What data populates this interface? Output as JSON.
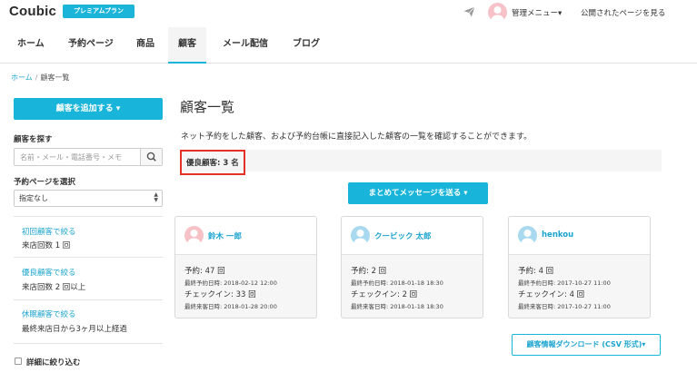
{
  "header": {
    "logo": "Coubic",
    "plan_badge": "プレミアムプラン",
    "admin_menu": "管理メニュー▾",
    "public_link": "公開されたページを見る"
  },
  "nav": {
    "tabs": [
      {
        "label": "ホーム",
        "active": false
      },
      {
        "label": "予約ページ",
        "active": false
      },
      {
        "label": "商品",
        "active": false
      },
      {
        "label": "顧客",
        "active": true
      },
      {
        "label": "メール配信",
        "active": false
      },
      {
        "label": "ブログ",
        "active": false
      }
    ]
  },
  "breadcrumb": {
    "home": "ホーム",
    "separator": "/",
    "current": "顧客一覧"
  },
  "sidebar": {
    "add_button": "顧客を追加する ▾",
    "search_label": "顧客を探す",
    "search_placeholder": "名前・メール・電話番号・メモ",
    "page_select_label": "予約ページを選択",
    "page_select_value": "指定なし",
    "filters": [
      {
        "title": "初回顧客で絞る",
        "desc": "来店回数 1 回"
      },
      {
        "title": "優良顧客で絞る",
        "desc": "来店回数 2 回以上"
      },
      {
        "title": "休眠顧客で絞る",
        "desc": "最終来店日から3ヶ月以上経過"
      }
    ],
    "detail_filter_label": "詳細に絞り込む"
  },
  "main": {
    "title": "顧客一覧",
    "description": "ネット予約をした顧客、および予約台帳に直接記入した顧客の一覧を確認することができます。",
    "good_customers": "優良顧客: 3 名",
    "bulk_message_button": "まとめてメッセージを送る ▾",
    "csv_button": "顧客情報ダウンロード (CSV 形式)▾",
    "cards": [
      {
        "name": "鈴木 一郎",
        "avatar_color": "#f6c2c8",
        "reservations": "予約: 47 回",
        "last_reservation": "最終予約日時: 2018-02-12 12:00",
        "checkins": "チェックイン: 33 回",
        "last_visit": "最終来客日時: 2018-01-28 20:00"
      },
      {
        "name": "クービック 太郎",
        "avatar_color": "#a9d9ef",
        "reservations": "予約: 2 回",
        "last_reservation": "最終予約日時: 2018-01-18 18:30",
        "checkins": "チェックイン: 2 回",
        "last_visit": "最終来客日時: 2018-01-18 18:30"
      },
      {
        "name": "henkou",
        "avatar_color": "#a9d9ef",
        "reservations": "予約: 4 回",
        "last_reservation": "最終予約日時: 2017-10-27 11:00",
        "checkins": "チェックイン: 4 回",
        "last_visit": "最終来客日時: 2017-10-27 11:00"
      }
    ]
  },
  "colors": {
    "accent": "#19b4d9",
    "link": "#1aa4cf",
    "highlight_border": "#e53025"
  },
  "icons": {
    "send": "paper-plane-icon",
    "search": "magnifier-icon",
    "avatar": "person-silhouette-icon",
    "select": "up-down-arrows-icon"
  }
}
